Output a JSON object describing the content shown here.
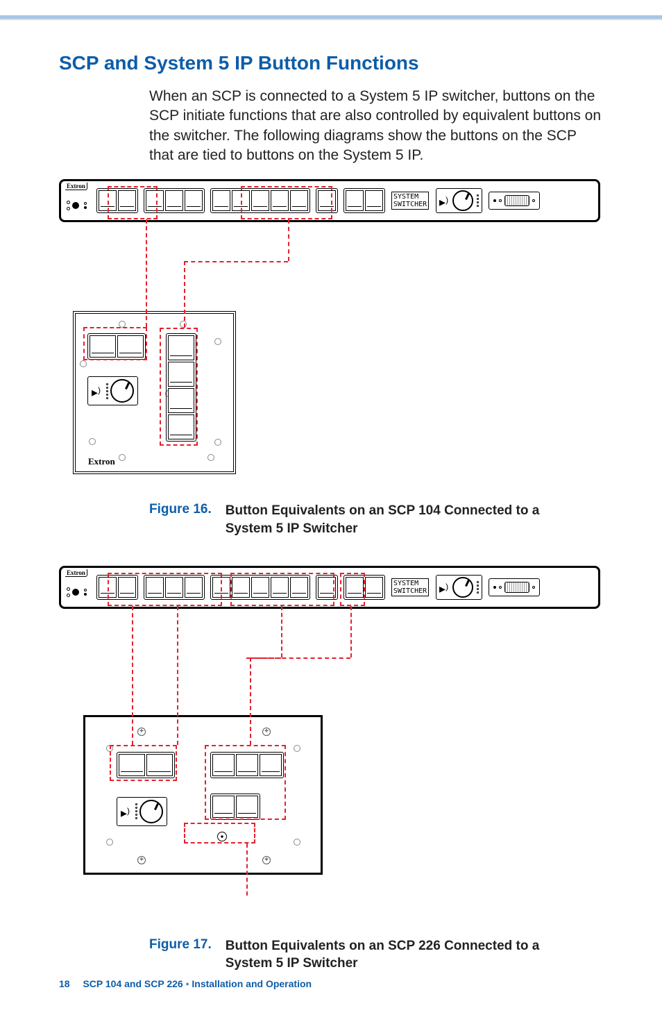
{
  "section_title": "SCP and System 5 IP Button Functions",
  "body_paragraph": "When an SCP is connected to a System 5 IP switcher, buttons on the SCP initiate functions that are also controlled by equivalent buttons on the switcher. The following diagrams show the buttons on the SCP that are tied to buttons on the System 5 IP.",
  "switcher_brand": "Extron",
  "switcher_system_label": "SYSTEM\nSWITCHER",
  "scp_brand": "Extron",
  "figure16": {
    "num": "Figure 16.",
    "text": "Button Equivalents on an SCP 104 Connected to a System 5 IP Switcher"
  },
  "figure17": {
    "num": "Figure 17.",
    "text": "Button Equivalents on an SCP 226 Connected to a System 5 IP Switcher"
  },
  "footer": {
    "page": "18",
    "doc": "SCP 104 and SCP 226",
    "section": "Installation and Operation"
  }
}
